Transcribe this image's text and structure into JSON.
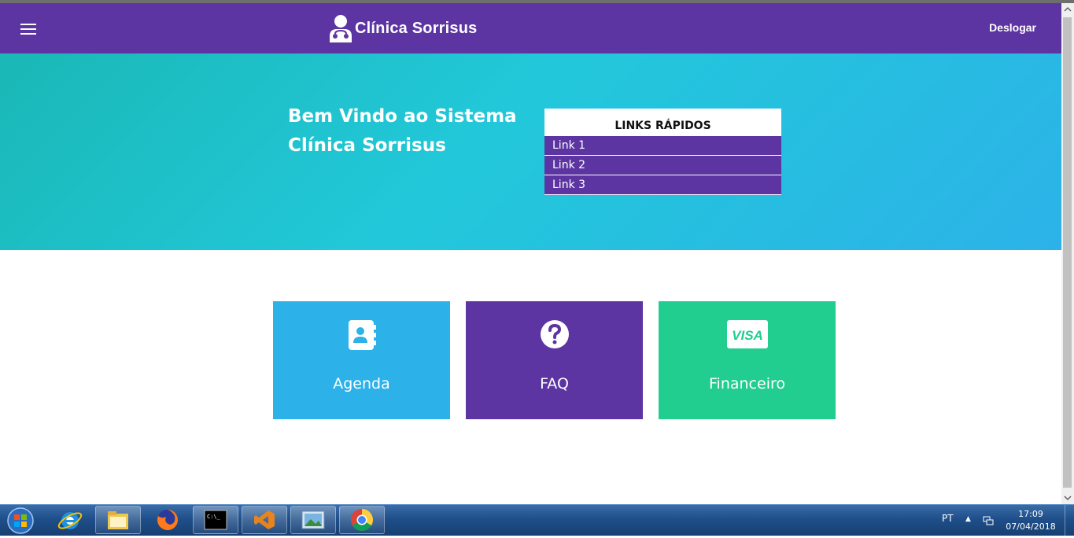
{
  "navbar": {
    "brand": "Clínica Sorrisus",
    "logout": "Deslogar",
    "color": "#5c35a2"
  },
  "hero": {
    "welcome_line1": "Bem Vindo ao Sistema",
    "welcome_line2": "Clínica Sorrisus",
    "quick_links": {
      "title": "LINKS RÁPIDOS",
      "items": [
        "Link 1",
        "Link 2",
        "Link 3"
      ]
    }
  },
  "tiles": [
    {
      "label": "Agenda",
      "icon": "address-book-icon",
      "color": "#2db1e9"
    },
    {
      "label": "FAQ",
      "icon": "question-circle-icon",
      "color": "#5c35a2"
    },
    {
      "label": "Financeiro",
      "icon": "visa-card-icon",
      "color": "#22cd90"
    }
  ],
  "taskbar": {
    "language": "PT",
    "time": "17:09",
    "date": "07/04/2018",
    "apps": [
      "start-orb-icon",
      "internet-explorer-icon",
      "file-explorer-icon",
      "firefox-icon",
      "command-prompt-icon",
      "visual-studio-icon",
      "image-viewer-icon",
      "chrome-icon"
    ]
  },
  "icon_text": {
    "visa": "VISA",
    "cmd": "C:\\_"
  }
}
